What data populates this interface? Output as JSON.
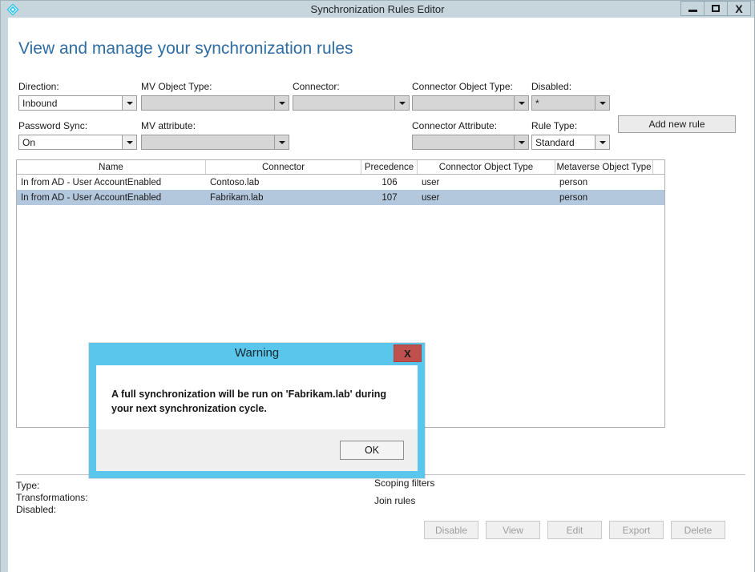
{
  "window": {
    "title": "Synchronization Rules Editor",
    "icon": "sync-diamond-icon",
    "controls": {
      "minimize": "minimize-icon",
      "maximize": "maximize-icon",
      "close": "X"
    }
  },
  "page": {
    "heading": "View and manage your synchronization rules",
    "heading_color": "#2e6da4"
  },
  "filters": [
    {
      "label": "Direction:",
      "value": "Inbound",
      "disabled": false,
      "name": "direction"
    },
    {
      "label": "MV Object Type:",
      "value": "",
      "disabled": true,
      "name": "mv-object-type"
    },
    {
      "label": "Connector:",
      "value": "",
      "disabled": true,
      "name": "connector"
    },
    {
      "label": "Connector Object Type:",
      "value": "",
      "disabled": true,
      "name": "connector-object-type"
    },
    {
      "label": "Disabled:",
      "value": "*",
      "disabled": true,
      "name": "disabled"
    },
    {
      "label": "Password Sync:",
      "value": "On",
      "disabled": false,
      "name": "password-sync"
    },
    {
      "label": "MV attribute:",
      "value": "",
      "disabled": true,
      "name": "mv-attribute"
    },
    {
      "label": "Connector Attribute:",
      "value": "",
      "disabled": true,
      "name": "connector-attribute"
    },
    {
      "label": "Rule Type:",
      "value": "Standard",
      "disabled": false,
      "name": "rule-type"
    }
  ],
  "add_new_rule_label": "Add new rule",
  "grid": {
    "columns": [
      "Name",
      "Connector",
      "Precedence",
      "Connector Object Type",
      "Metaverse Object Type"
    ],
    "rows": [
      {
        "name": "In from AD - User AccountEnabled",
        "connector": "Contoso.lab",
        "precedence": "106",
        "connector_object_type": "user",
        "metaverse_object_type": "person",
        "selected": false
      },
      {
        "name": "In from AD - User AccountEnabled",
        "connector": "Fabrikam.lab",
        "precedence": "107",
        "connector_object_type": "user",
        "metaverse_object_type": "person",
        "selected": true
      }
    ],
    "selected_row_color": "#b3c7dd"
  },
  "detail": {
    "left": [
      "Type:",
      "Transformations:",
      "Disabled:"
    ],
    "right": [
      "Scoping filters",
      "Join rules"
    ]
  },
  "footer_buttons": [
    {
      "label": "Disable",
      "name": "disable"
    },
    {
      "label": "View",
      "name": "view"
    },
    {
      "label": "Edit",
      "name": "edit"
    },
    {
      "label": "Export",
      "name": "export"
    },
    {
      "label": "Delete",
      "name": "delete"
    }
  ],
  "dialog": {
    "title": "Warning",
    "close_label": "X",
    "message": "A full synchronization will be run on 'Fabrikam.lab' during your next synchronization cycle.",
    "ok_label": "OK",
    "border_color": "#5bc6ec",
    "close_color": "#c0504d"
  }
}
